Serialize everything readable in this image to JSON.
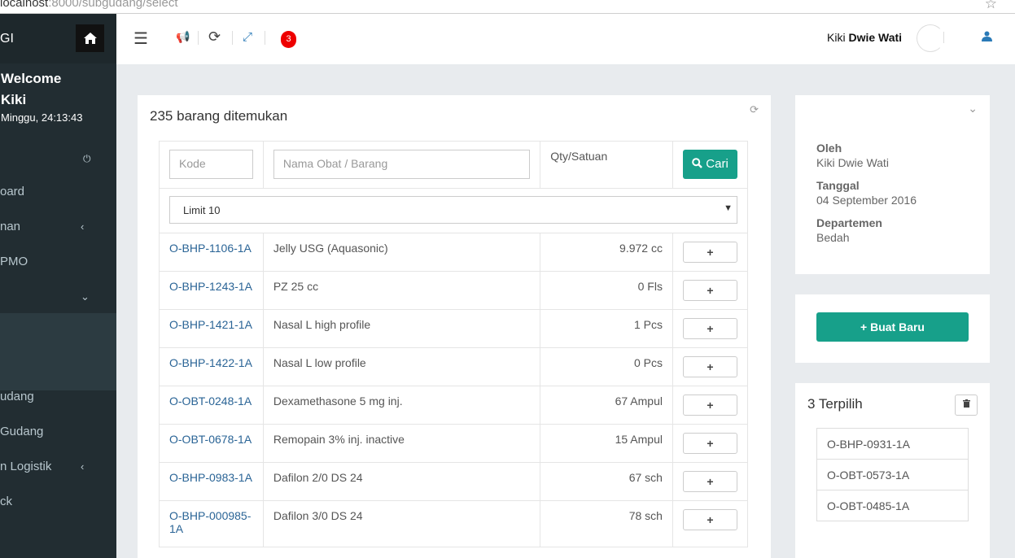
{
  "browser": {
    "url_host": "localhost",
    "url_path": ":8000/subgudang/select"
  },
  "sidebar": {
    "brand": "GI",
    "welcome_line1": "Welcome",
    "welcome_line2": "Kiki",
    "datetime": "Minggu, 24:13:43",
    "items": [
      {
        "label": "oard"
      },
      {
        "label": "nan"
      },
      {
        "label": "PMO"
      },
      {
        "label": ""
      },
      {
        "label": "udang"
      },
      {
        "label": "Gudang"
      },
      {
        "label": "n Logistik"
      },
      {
        "label": "ck"
      }
    ]
  },
  "navbar": {
    "notification_count": "3",
    "user_first": "Kiki",
    "user_rest": "Dwie Wati"
  },
  "main": {
    "count": "235",
    "count_label": "barang ditemukan",
    "search": {
      "code_placeholder": "Kode",
      "name_placeholder": "Nama Obat / Barang",
      "qty_header": "Qty/Satuan",
      "search_button": "Cari"
    },
    "limit_selected": "Limit 10",
    "add_label": "+",
    "rows": [
      {
        "code": "O-BHP-1106-1A",
        "name": "Jelly USG (Aquasonic)",
        "qty": "9.972 cc"
      },
      {
        "code": "O-BHP-1243-1A",
        "name": "PZ 25 cc",
        "qty": "0 Fls"
      },
      {
        "code": "O-BHP-1421-1A",
        "name": "Nasal L high profile",
        "qty": "1 Pcs"
      },
      {
        "code": "O-BHP-1422-1A",
        "name": "Nasal L low profile",
        "qty": "0 Pcs"
      },
      {
        "code": "O-OBT-0248-1A",
        "name": "Dexamethasone 5 mg inj.",
        "qty": "67 Ampul"
      },
      {
        "code": "O-OBT-0678-1A",
        "name": "Remopain 3% inj. inactive",
        "qty": "15 Ampul"
      },
      {
        "code": "O-BHP-0983-1A",
        "name": "Dafilon 2/0 DS 24",
        "qty": "67 sch"
      },
      {
        "code": "O-BHP-000985-1A",
        "name": "Dafilon 3/0 DS 24",
        "qty": "78 sch"
      }
    ]
  },
  "info": {
    "by_label": "Oleh",
    "by_value": "Kiki Dwie Wati",
    "date_label": "Tanggal",
    "date_value": "04 September 2016",
    "dept_label": "Departemen",
    "dept_value": "Bedah"
  },
  "create_button": "Buat Baru",
  "selected": {
    "count": "3",
    "label": "Terpilih",
    "items": [
      "O-BHP-0931-1A",
      "O-OBT-0573-1A",
      "O-OBT-0485-1A"
    ]
  },
  "colors": {
    "sidebar": "#222d32",
    "accent": "#17a08a",
    "badge": "#ee0000",
    "link": "#2a6496"
  }
}
